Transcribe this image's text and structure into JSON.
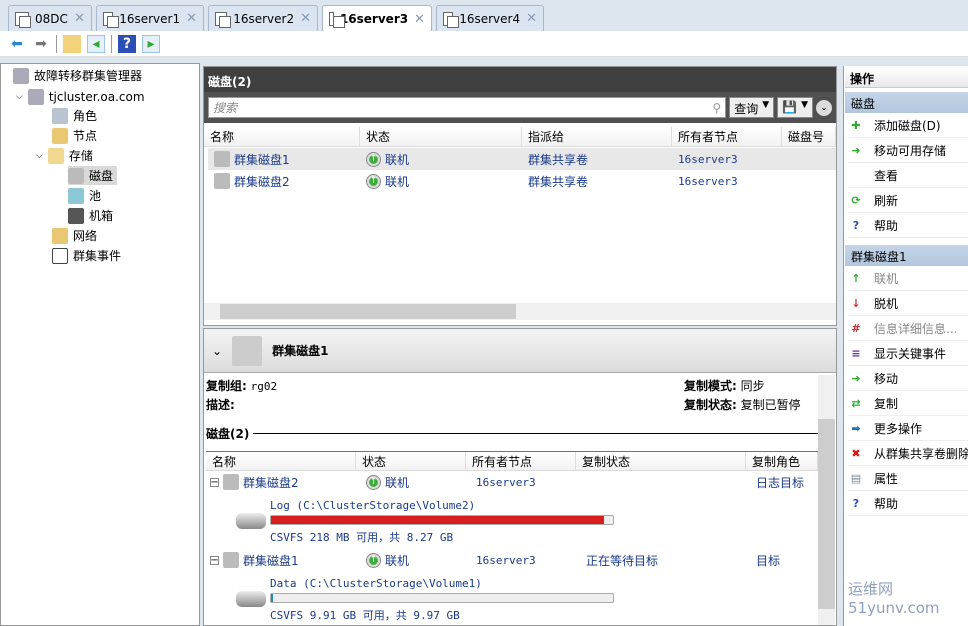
{
  "tabs": [
    {
      "label": "08DC"
    },
    {
      "label": "16server1"
    },
    {
      "label": "16server2"
    },
    {
      "label": "16server3",
      "active": true
    },
    {
      "label": "16server4"
    }
  ],
  "tree": {
    "root": "故障转移群集管理器",
    "cluster": "tjcluster.oa.com",
    "items": [
      "角色",
      "节点",
      "存储",
      "磁盘",
      "池",
      "机箱",
      "网络",
      "群集事件"
    ]
  },
  "center": {
    "title": "磁盘(2)",
    "search_placeholder": "搜索",
    "query_label": "查询",
    "columns": [
      "名称",
      "状态",
      "指派给",
      "所有者节点",
      "磁盘号"
    ],
    "rows": [
      {
        "name": "群集磁盘1",
        "status": "联机",
        "assigned": "群集共享卷",
        "owner": "16server3"
      },
      {
        "name": "群集磁盘2",
        "status": "联机",
        "assigned": "群集共享卷",
        "owner": "16server3"
      }
    ]
  },
  "detail": {
    "title": "群集磁盘1",
    "group_label": "复制组:",
    "group_value": "rg02",
    "desc_label": "描述:",
    "mode_label": "复制模式:",
    "mode_value": "同步",
    "state_label": "复制状态:",
    "state_value": "复制已暂停",
    "disks_label": "磁盘(2)",
    "columns": [
      "名称",
      "状态",
      "所有者节点",
      "复制状态",
      "复制角色"
    ],
    "disks": [
      {
        "name": "群集磁盘2",
        "status": "联机",
        "owner": "16server3",
        "repl_state": "",
        "role": "日志目标",
        "volume": "Log (C:\\ClusterStorage\\Volume2)",
        "usage": "CSVFS 218 MB 可用，共 8.27 GB",
        "used_fraction": 0.974,
        "bar_color": "#d81e1e"
      },
      {
        "name": "群集磁盘1",
        "status": "联机",
        "owner": "16server3",
        "repl_state": "正在等待目标",
        "role": "目标",
        "volume": "Data (C:\\ClusterStorage\\Volume1)",
        "usage": "CSVFS 9.91 GB 可用，共 9.97 GB",
        "used_fraction": 0.006,
        "bar_color": "#2a8ab8"
      }
    ]
  },
  "actions": {
    "header": "操作",
    "section1": "磁盘",
    "items1": [
      "添加磁盘(D)",
      "移动可用存储",
      "查看",
      "刷新",
      "帮助"
    ],
    "section2": "群集磁盘1",
    "items2": [
      "联机",
      "脱机",
      "信息详细信息...",
      "显示关键事件",
      "移动",
      "复制",
      "更多操作",
      "从群集共享卷删除",
      "属性",
      "帮助"
    ]
  },
  "watermark": "运维网 51yunv.com"
}
